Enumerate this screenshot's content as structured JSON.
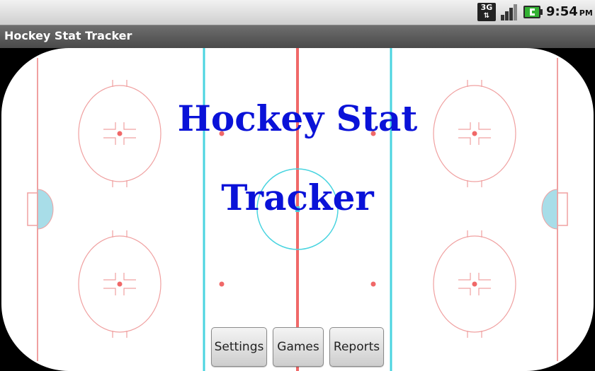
{
  "status_bar": {
    "network_label": "3G",
    "time": "9:54",
    "ampm": "PM",
    "battery_color": "#33b233"
  },
  "title_bar": {
    "title": "Hockey Stat Tracker"
  },
  "main": {
    "headline_line1": "Hockey Stat",
    "headline_line2": "Tracker",
    "headline_color": "#0a12d8"
  },
  "buttons": {
    "settings": "Settings",
    "games": "Games",
    "reports": "Reports"
  },
  "rink_colors": {
    "ice": "#ffffff",
    "red_line": "#f06868",
    "blue_line": "#49d4e0",
    "crease": "#a8dde8",
    "face_off": "#f0a0a0"
  }
}
